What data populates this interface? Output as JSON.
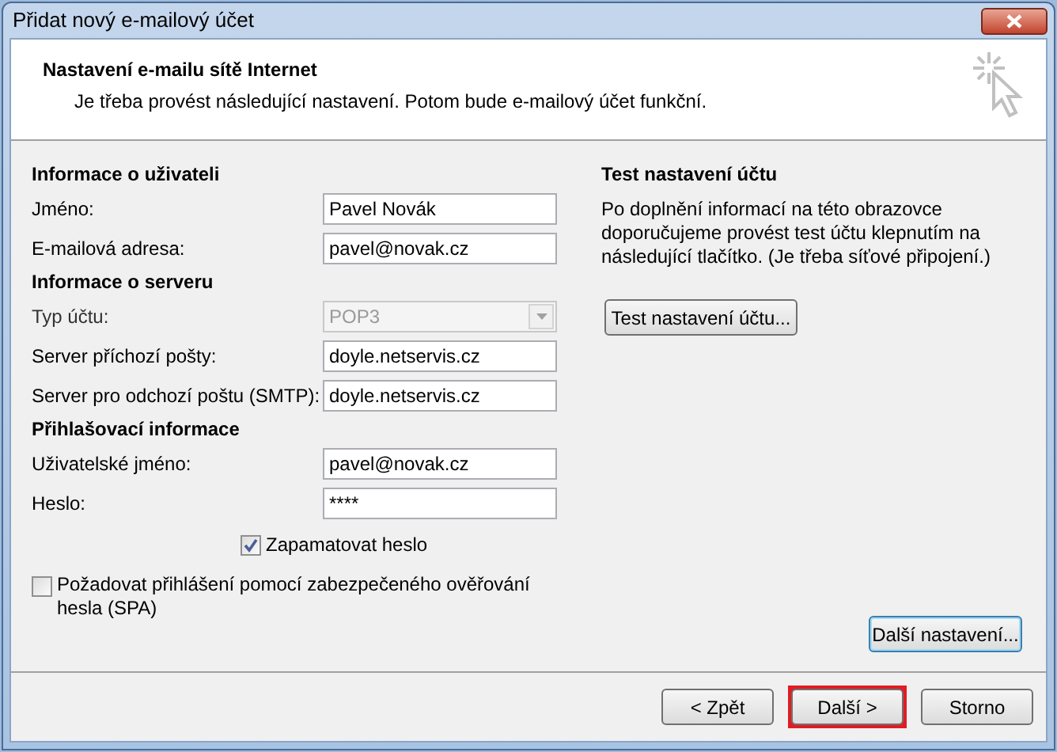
{
  "window": {
    "title": "Přidat nový e-mailový účet"
  },
  "header": {
    "title": "Nastavení e-mailu sítě Internet",
    "subtitle": "Je třeba provést následující nastavení. Potom bude e-mailový účet funkční."
  },
  "sections": [
    {
      "title": "Informace o uživateli",
      "fields": [
        {
          "kind": "text",
          "label": "Jméno:",
          "value": "Pavel Novák",
          "disabled": false
        },
        {
          "kind": "text",
          "label": "E-mailová adresa:",
          "value": "pavel@novak.cz",
          "disabled": false
        }
      ]
    },
    {
      "title": "Informace o serveru",
      "fields": [
        {
          "kind": "select",
          "label": "Typ účtu:",
          "value": "POP3",
          "disabled": true
        },
        {
          "kind": "text",
          "label": "Server příchozí pošty:",
          "value": "doyle.netservis.cz",
          "disabled": false
        },
        {
          "kind": "text",
          "label": "Server pro odchozí poštu (SMTP):",
          "value": "doyle.netservis.cz",
          "disabled": false
        }
      ]
    },
    {
      "title": "Přihlašovací informace",
      "fields": [
        {
          "kind": "text",
          "label": "Uživatelské jméno:",
          "value": "pavel@novak.cz",
          "disabled": false
        },
        {
          "kind": "password",
          "label": "Heslo:",
          "value": "****",
          "disabled": false
        }
      ]
    }
  ],
  "remember_password": {
    "label": "Zapamatovat heslo",
    "checked": true
  },
  "spa": {
    "label": "Požadovat přihlášení pomocí zabezpečeného ověřování hesla (SPA)",
    "checked": false
  },
  "test": {
    "title": "Test nastavení účtu",
    "text": "Po doplnění informací na této obrazovce doporučujeme provést test účtu klepnutím na následující tlačítko. (Je třeba síťové připojení.)",
    "button": "Test nastavení účtu..."
  },
  "more_settings_button": {
    "label": "Další nastavení...",
    "focused": true
  },
  "buttons": [
    {
      "label": "< Zpět",
      "highlighted": false
    },
    {
      "label": "Další >",
      "highlighted": true
    },
    {
      "label": "Storno",
      "highlighted": false
    }
  ]
}
